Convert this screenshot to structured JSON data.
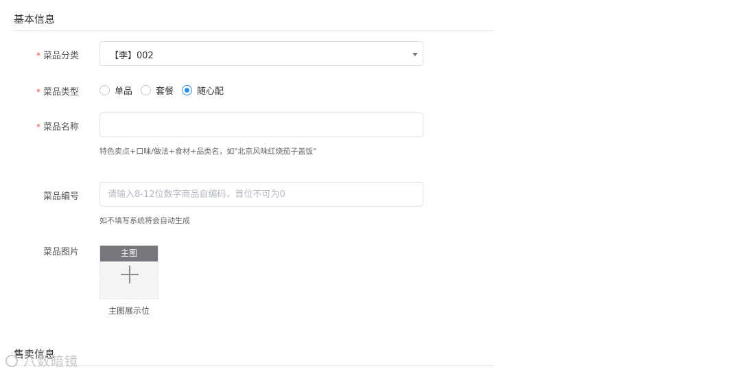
{
  "sections": {
    "basic_info": "基本信息",
    "sales_info": "售卖信息"
  },
  "form": {
    "category": {
      "label": "菜品分类",
      "value": "【李】002"
    },
    "dish_type": {
      "label": "菜品类型",
      "options": [
        "单品",
        "套餐",
        "随心配"
      ],
      "selected": "随心配"
    },
    "dish_name": {
      "label": "菜品名称",
      "value": "",
      "hint": "特色卖点+口味/做法+食材+品类名，如\"北京风味红烧茄子盖饭\""
    },
    "dish_code": {
      "label": "菜品编号",
      "placeholder": "请输入8-12位数字商品自编码，首位不可为0",
      "hint": "如不填写系统将会自动生成"
    },
    "dish_image": {
      "label": "菜品图片",
      "tag": "主图",
      "caption": "主图展示位"
    }
  },
  "watermark": {
    "text": "八数暗镜"
  },
  "colors": {
    "required": "#e54d42",
    "accent": "#2d8cf0",
    "border": "#dcdfe6"
  }
}
